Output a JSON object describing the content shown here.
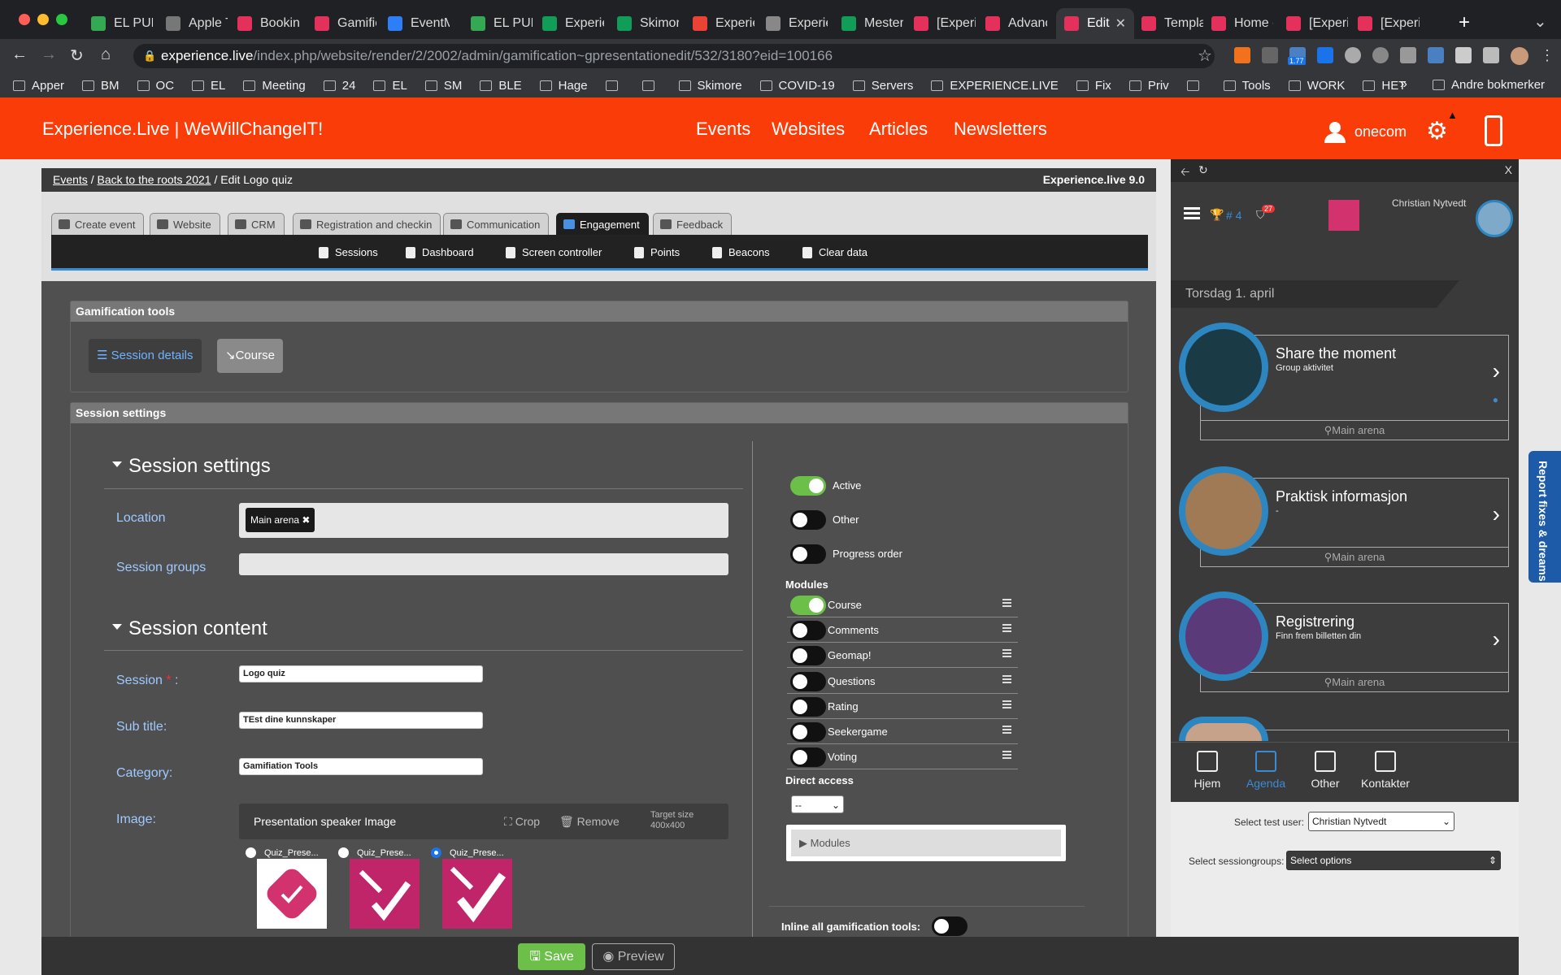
{
  "browser": {
    "tabs": [
      {
        "label": "EL PUB",
        "color": "#34a853"
      },
      {
        "label": "Apple T",
        "color": "#777777"
      },
      {
        "label": "Bookin",
        "color": "#e3315b"
      },
      {
        "label": "Gamific",
        "color": "#e3315b"
      },
      {
        "label": "EventM",
        "color": "#2d7ff9"
      },
      {
        "label": "EL PUB",
        "color": "#34a853"
      },
      {
        "label": "Experie",
        "color": "#0f9d58"
      },
      {
        "label": "Skimor",
        "color": "#0f9d58"
      },
      {
        "label": "Experie",
        "color": "#ea4335"
      },
      {
        "label": "Experie",
        "color": "#888888"
      },
      {
        "label": "Mester",
        "color": "#0f9d58"
      },
      {
        "label": "[Experi",
        "color": "#e3315b"
      },
      {
        "label": "Advanc",
        "color": "#e3315b"
      },
      {
        "label": "Edit",
        "color": "#e3315b"
      },
      {
        "label": "Templa",
        "color": "#e3315b"
      },
      {
        "label": "Home c",
        "color": "#e3315b"
      },
      {
        "label": "[Experi",
        "color": "#e3315b"
      },
      {
        "label": "[Experi",
        "color": "#e3315b"
      }
    ],
    "new_tab": "+",
    "url_host": "experience.live",
    "url_path": "/index.php/website/render/2/2002/admin/gamification~gpresentationedit/532/3180?eid=100166",
    "bookmarks": [
      "Apper",
      "BM",
      "OC",
      "EL",
      "Meeting",
      "24",
      "EL",
      "SM",
      "BLE",
      "Hage",
      "",
      "",
      "Skimore",
      "COVID-19",
      "Servers",
      "EXPERIENCE.LIVE",
      "Fix",
      "Priv",
      "",
      "Tools",
      "WORK",
      "HET"
    ],
    "bookmarks_more": "»",
    "other_bookmarks": "Andre bokmerker",
    "ext_badge": "1.77"
  },
  "app": {
    "brand": "Experience.Live | WeWillChangeIT!",
    "nav": [
      "Events",
      "Websites",
      "Articles",
      "Newsletters"
    ],
    "user": "onecom",
    "breadcrumb": {
      "events": "Events",
      "sep1": "/",
      "event": "Back to the roots 2021",
      "rest": "/ Edit Logo quiz"
    },
    "version": "Experience.live 9.0",
    "main_tabs": [
      "Create event",
      "Website",
      "CRM",
      "Registration and checkin",
      "Communication",
      "Engagement",
      "Feedback"
    ],
    "sub_nav": [
      "Sessions",
      "Dashboard",
      "Screen controller",
      "Points",
      "Beacons",
      "Clear data"
    ]
  },
  "gamification": {
    "title": "Gamification tools",
    "btn_details": "Session details",
    "btn_course": "Course"
  },
  "settings": {
    "panel_title": "Session settings",
    "sec1": "Session settings",
    "location_label": "Location",
    "location_tag": "Main arena",
    "groups_label": "Session groups",
    "sec2": "Session content",
    "session_label": "Session",
    "session_value": "Logo quiz",
    "subtitle_label": "Sub title:",
    "subtitle_value": "TEst dine kunnskaper",
    "category_label": "Category:",
    "category_value": "Gamifiation Tools",
    "image_label": "Image:",
    "image_title": "Presentation speaker Image",
    "crop": "Crop",
    "remove": "Remove",
    "target_size": "Target size",
    "target_dim": "400x400",
    "thumbs": [
      "Quiz_Prese...",
      "Quiz_Prese...",
      "Quiz_Prese..."
    ],
    "toggles": [
      {
        "label": "Active",
        "on": true
      },
      {
        "label": "Other",
        "on": false
      },
      {
        "label": "Progress order",
        "on": false
      }
    ],
    "modules_title": "Modules",
    "modules": [
      {
        "label": "Course",
        "on": true
      },
      {
        "label": "Comments",
        "on": false
      },
      {
        "label": "Geomap!",
        "on": false
      },
      {
        "label": "Questions",
        "on": false
      },
      {
        "label": "Rating",
        "on": false
      },
      {
        "label": "Seekergame",
        "on": false
      },
      {
        "label": "Voting",
        "on": false
      }
    ],
    "direct_access": "Direct access",
    "direct_value": "--",
    "modules_box": "Modules",
    "inline_label": "Inline all gamification tools:"
  },
  "preview": {
    "close": "X",
    "user": "Christian Nytvedt",
    "rank": "# 4",
    "notif": "27",
    "date": "Torsdag 1. april",
    "cards": [
      {
        "title": "Share the moment",
        "sub": "Group aktivitet",
        "loc": "Main arena"
      },
      {
        "title": "Praktisk informasjon",
        "sub": "-",
        "loc": "Main arena"
      },
      {
        "title": "Registrering",
        "sub": "Finn frem billetten din",
        "loc": "Main arena"
      }
    ],
    "bottom_nav": [
      "Hjem",
      "Agenda",
      "Other",
      "Kontakter"
    ],
    "test_user_label": "Select test user:",
    "test_user_value": "Christian Nytvedt",
    "groups_label": "Select sessiongroups:",
    "groups_value": "Select options"
  },
  "footer": {
    "save": "Save",
    "preview": "Preview"
  },
  "report": "Report fixes & dreams",
  "colors": {
    "brand": "#fa3d08",
    "toggle_on": "#6cc04a",
    "accent": "#3a8bd6",
    "save": "#6cc04a"
  }
}
